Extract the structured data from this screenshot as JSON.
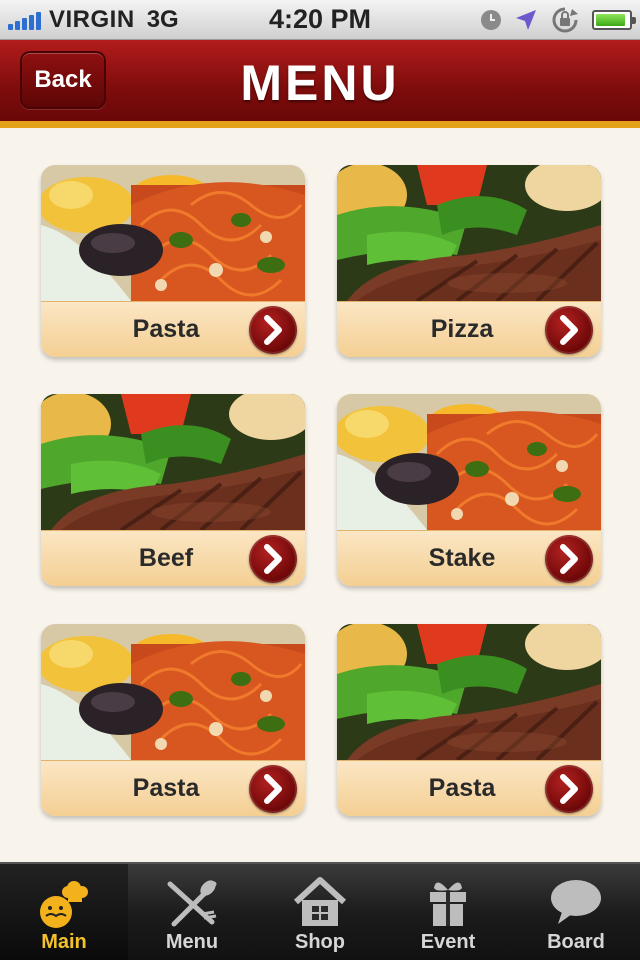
{
  "status_bar": {
    "carrier": "VIRGIN",
    "network": "3G",
    "time": "4:20 PM",
    "signal_bars": 5,
    "battery_level": 0.9,
    "icons": [
      "signal-icon",
      "clock-icon",
      "location-arrow-icon",
      "rotation-lock-icon",
      "battery-icon"
    ]
  },
  "header": {
    "back_label": "Back",
    "title": "MENU"
  },
  "menu_items": [
    {
      "label": "Pasta",
      "photo": "pasta"
    },
    {
      "label": "Pizza",
      "photo": "steak"
    },
    {
      "label": "Beef",
      "photo": "steak"
    },
    {
      "label": "Stake",
      "photo": "pasta"
    },
    {
      "label": "Pasta",
      "photo": "pasta"
    },
    {
      "label": "Pasta",
      "photo": "steak"
    }
  ],
  "tabs": [
    {
      "label": "Main",
      "icon": "chef-icon",
      "active": true
    },
    {
      "label": "Menu",
      "icon": "fork-spoon-icon",
      "active": false
    },
    {
      "label": "Shop",
      "icon": "house-icon",
      "active": false
    },
    {
      "label": "Event",
      "icon": "gift-icon",
      "active": false
    },
    {
      "label": "Board",
      "icon": "speech-bubble-icon",
      "active": false
    }
  ],
  "colors": {
    "header_red": "#8a0f0f",
    "accent_gold": "#e4a21a",
    "active_tab": "#f1c12e",
    "background": "#f8f4ec"
  }
}
